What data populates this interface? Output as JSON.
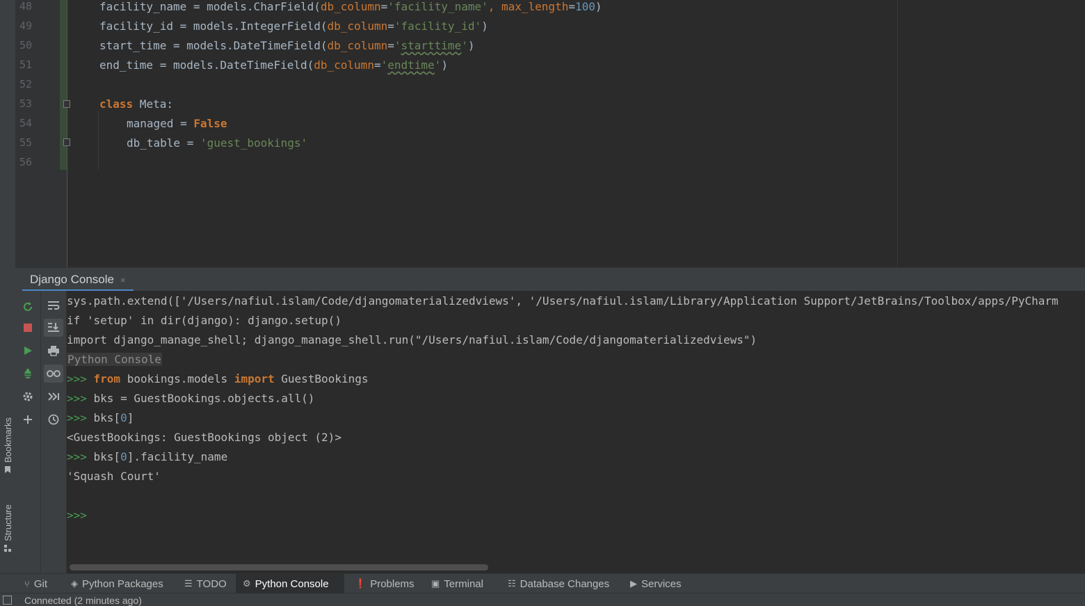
{
  "left_stripe": {
    "bookmarks_label": "Bookmarks",
    "structure_label": "Structure"
  },
  "editor": {
    "line_numbers": [
      "48",
      "49",
      "50",
      "51",
      "52",
      "53",
      "54",
      "55",
      "56"
    ],
    "lines": {
      "l48": {
        "a": "facility_name = models.CharField(",
        "p1": "db_column",
        "eq1": "=",
        "s1": "'facility_name'",
        "comma": ", ",
        "p2": "max_length",
        "eq2": "=",
        "n1": "100",
        "close": ")"
      },
      "l49": {
        "a": "facility_id = models.IntegerField(",
        "p1": "db_column",
        "eq1": "=",
        "s1": "'facility_id'",
        "close": ")"
      },
      "l50": {
        "a": "start_time = models.DateTimeField(",
        "p1": "db_column",
        "eq1": "=",
        "q1": "'",
        "s1": "starttime",
        "q2": "'",
        "close": ")"
      },
      "l51": {
        "a": "end_time = models.DateTimeField(",
        "p1": "db_column",
        "eq1": "=",
        "q1": "'",
        "s1": "endtime",
        "q2": "'",
        "close": ")"
      },
      "l53": {
        "kw": "class",
        "rest": " Meta:"
      },
      "l54": {
        "a": "managed = ",
        "kw": "False"
      },
      "l55": {
        "a": "db_table = ",
        "s1": "'guest_bookings'"
      }
    }
  },
  "console": {
    "tab_label": "Django Console",
    "tab_close": "×",
    "lines": {
      "c1": "sys.path.extend(['/Users/nafiul.islam/Code/djangomaterializedviews', '/Users/nafiul.islam/Library/Application Support/JetBrains/Toolbox/apps/PyCharm",
      "c2": "if 'setup' in dir(django): django.setup()",
      "c3": "import django_manage_shell; django_manage_shell.run(\"/Users/nafiul.islam/Code/djangomaterializedviews\")",
      "c4": "Python Console",
      "c5": {
        "prompt": ">>> ",
        "kw1": "from",
        "mid": " bookings.models ",
        "kw2": "import",
        "end": " GuestBookings"
      },
      "c6": {
        "prompt": ">>> ",
        "text": "bks = GuestBookings.objects.all()"
      },
      "c7": {
        "prompt": ">>> ",
        "a": "bks[",
        "idx": "0",
        "b": "]"
      },
      "c8": "<GuestBookings: GuestBookings object (2)>",
      "c9": {
        "prompt": ">>> ",
        "a": "bks[",
        "idx": "0",
        "b": "].facility_name"
      },
      "c10": "'Squash Court'",
      "c11": {
        "prompt": ">>>"
      }
    }
  },
  "tool_tabs": [
    {
      "label": "Git",
      "icon": "git-branch-icon",
      "glyph": "⑂"
    },
    {
      "label": "Python Packages",
      "icon": "layers-icon",
      "glyph": "◈"
    },
    {
      "label": "TODO",
      "icon": "list-icon",
      "glyph": "☰"
    },
    {
      "label": "Python Console",
      "icon": "python-icon",
      "glyph": "⚙"
    },
    {
      "label": "Problems",
      "icon": "info-icon",
      "glyph": "❗"
    },
    {
      "label": "Terminal",
      "icon": "terminal-icon",
      "glyph": "▣"
    },
    {
      "label": "Database Changes",
      "icon": "database-icon",
      "glyph": "☷"
    },
    {
      "label": "Services",
      "icon": "play-circle-icon",
      "glyph": "▶"
    }
  ],
  "status": {
    "text": "Connected (2 minutes ago)"
  },
  "colors": {
    "background": "#2b2b2b",
    "keyword": "#cc7832",
    "string": "#6a8759",
    "number": "#6897bb",
    "prompt": "#499c54",
    "tab_underline": "#4a88c7",
    "stop": "#c75450",
    "run": "#499c54"
  }
}
